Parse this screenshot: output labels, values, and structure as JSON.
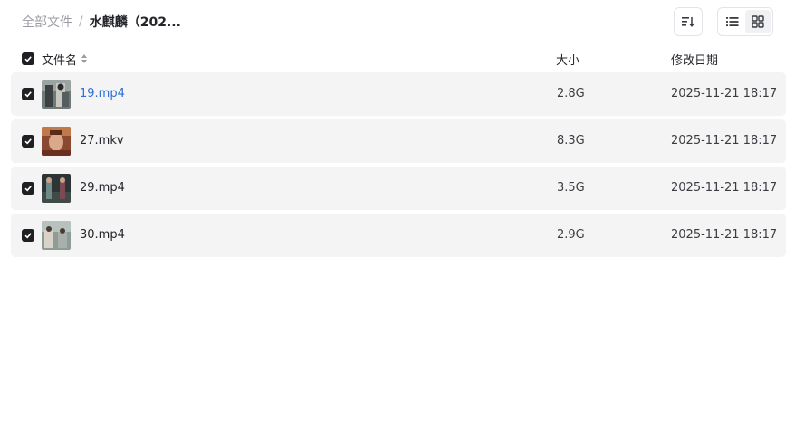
{
  "breadcrumb": {
    "root": "全部文件",
    "separator": "/",
    "current": "水麒麟（202..."
  },
  "toolbar": {
    "sort_icon": "sort-lines-icon",
    "list_view_icon": "list-view-icon",
    "grid_view_icon": "grid-view-icon",
    "active_view": "list"
  },
  "table": {
    "headers": {
      "name": "文件名",
      "size": "大小",
      "modified": "修改日期"
    },
    "select_all_checked": true,
    "rows": [
      {
        "name": "19.mp4",
        "size": "2.8G",
        "modified": "2025-11-21 18:17",
        "checked": true,
        "highlighted": true
      },
      {
        "name": "27.mkv",
        "size": "8.3G",
        "modified": "2025-11-21 18:17",
        "checked": true,
        "highlighted": false
      },
      {
        "name": "29.mp4",
        "size": "3.5G",
        "modified": "2025-11-21 18:17",
        "checked": true,
        "highlighted": false
      },
      {
        "name": "30.mp4",
        "size": "2.9G",
        "modified": "2025-11-21 18:17",
        "checked": true,
        "highlighted": false
      }
    ]
  },
  "colors": {
    "accent_link": "#2f6fd6",
    "row_bg": "#f4f4f5",
    "checkbox": "#1f2023"
  }
}
